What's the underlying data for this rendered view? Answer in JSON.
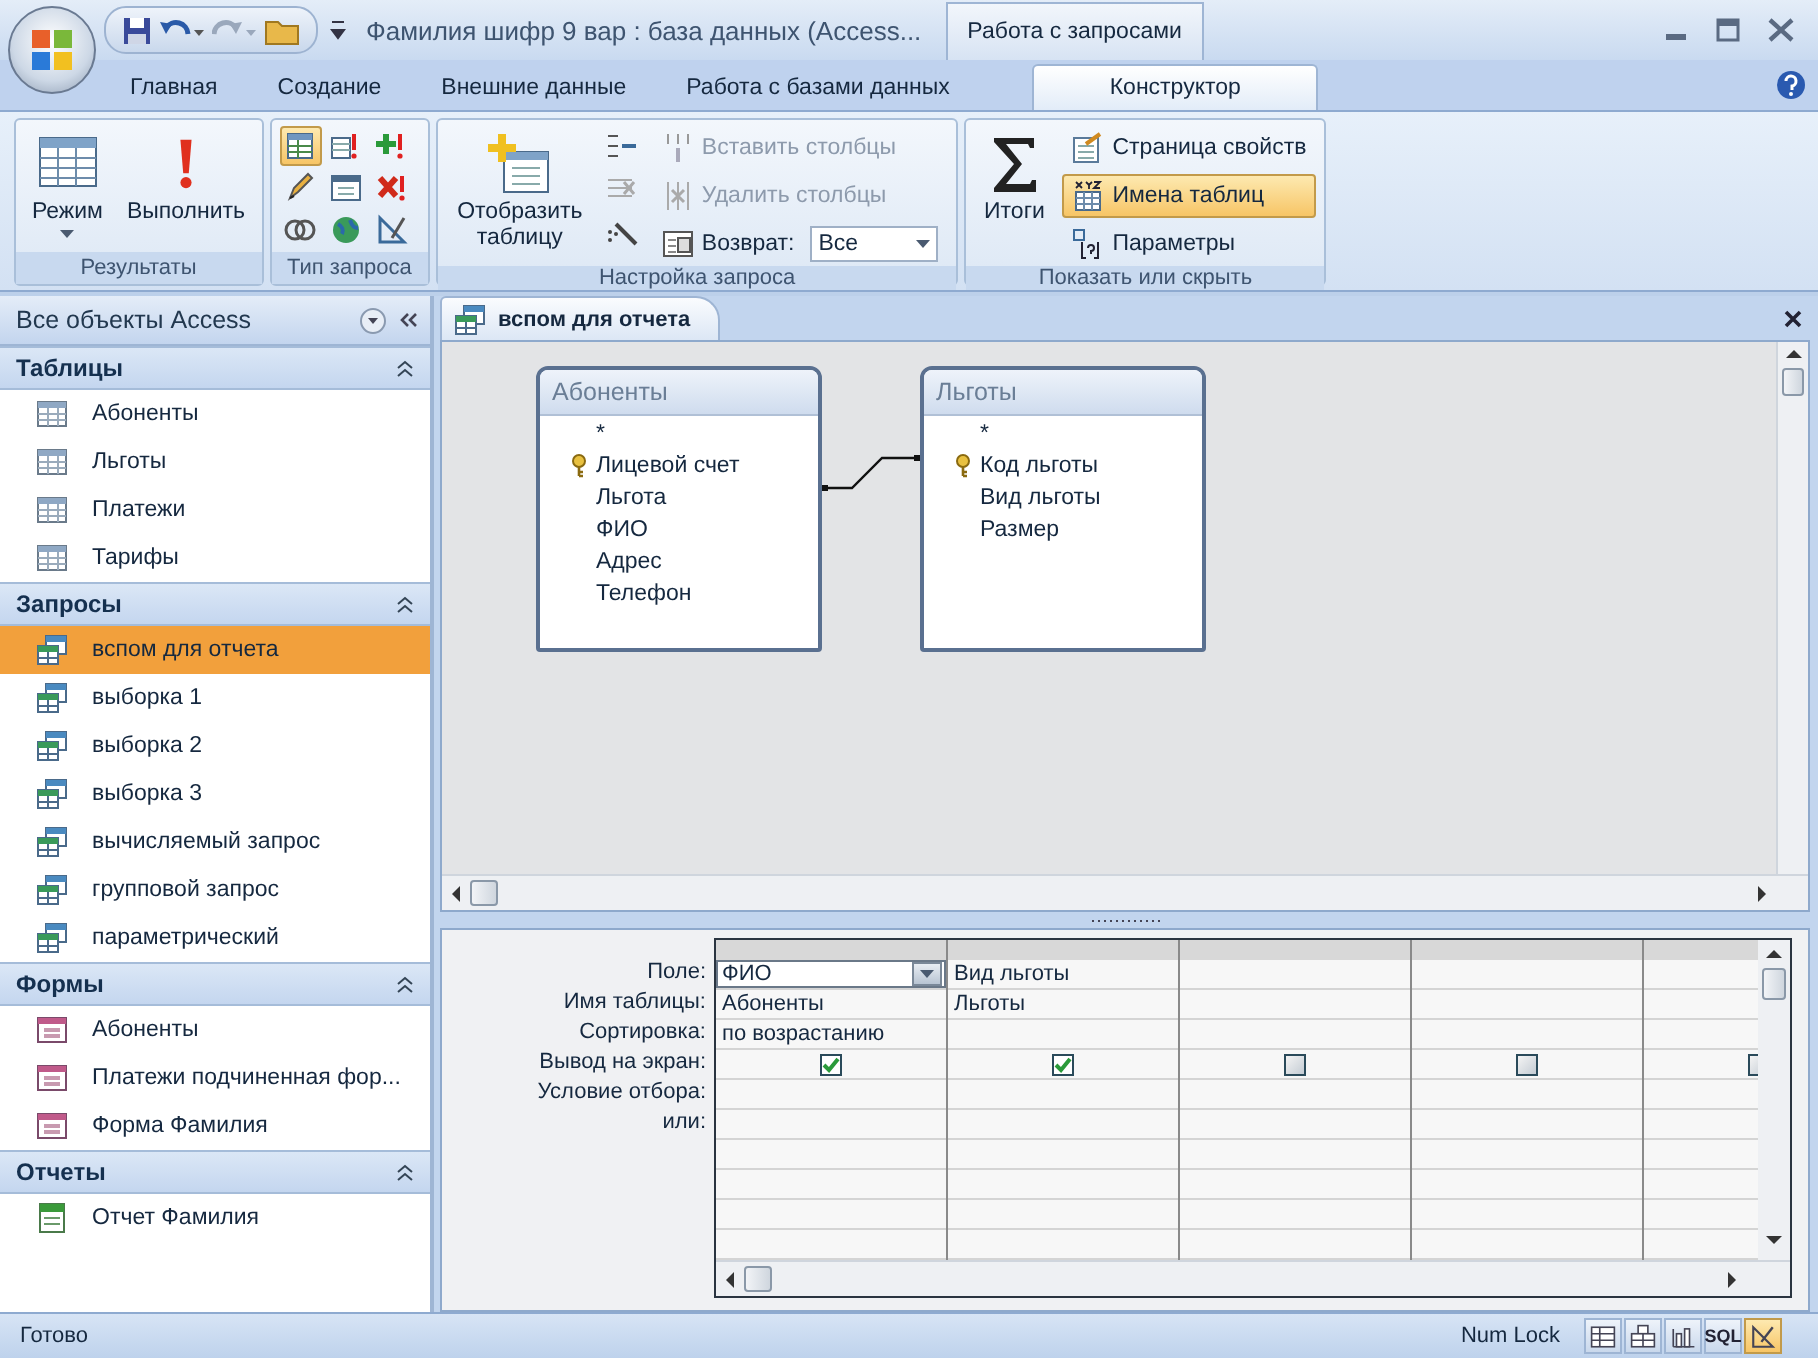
{
  "window": {
    "title": "Фамилия шифр 9 вар : база данных (Access..."
  },
  "context_tab_group": "Работа с запросами",
  "ribbon_tabs": [
    {
      "label": "Главная",
      "selected": false
    },
    {
      "label": "Создание",
      "selected": false
    },
    {
      "label": "Внешние данные",
      "selected": false
    },
    {
      "label": "Работа с базами данных",
      "selected": false
    },
    {
      "label": "Конструктор",
      "selected": true
    }
  ],
  "ribbon_groups": [
    {
      "title": "Результаты",
      "large": [
        {
          "kind": "view",
          "label": "Режим",
          "dropdown": true
        },
        {
          "kind": "run",
          "label": "Выполнить",
          "dropdown": false
        }
      ]
    },
    {
      "title": "Тип запроса",
      "icons": [
        {
          "kind": "select",
          "selected": true
        },
        {
          "kind": "update",
          "selected": false
        },
        {
          "kind": "crosstab",
          "selected": false
        },
        {
          "kind": "make-table",
          "selected": false
        },
        {
          "kind": "union",
          "selected": false
        },
        {
          "kind": "pass-through",
          "selected": false
        },
        {
          "kind": "append",
          "selected": false
        },
        {
          "kind": "delete",
          "selected": false
        },
        {
          "kind": "data-definition",
          "selected": false
        }
      ]
    },
    {
      "title": "Настройка запроса",
      "large": [
        {
          "kind": "show-table",
          "label": "Отобразить таблицу",
          "dropdown": false
        }
      ],
      "icons": [
        {
          "kind": "insert-rows",
          "selected": false
        },
        {
          "kind": "delete-rows",
          "selected": false
        },
        {
          "kind": "builder",
          "selected": false
        }
      ],
      "rows": [
        {
          "kind": "insert-columns",
          "label": "Вставить столбцы",
          "disabled": true,
          "selected": false
        },
        {
          "kind": "delete-columns",
          "label": "Удалить столбцы",
          "disabled": true,
          "selected": false
        },
        {
          "kind": "return",
          "label": "Возврат:",
          "value": "Все",
          "disabled": false,
          "selected": false
        }
      ]
    },
    {
      "title": "Показать или скрыть",
      "large": [
        {
          "kind": "totals",
          "label": "Итоги",
          "dropdown": false
        }
      ],
      "rows": [
        {
          "kind": "property-sheet",
          "label": "Страница свойств",
          "disabled": false,
          "selected": false
        },
        {
          "kind": "table-names",
          "label": "Имена таблиц",
          "disabled": false,
          "selected": true
        },
        {
          "kind": "parameters",
          "label": "Параметры",
          "disabled": false,
          "selected": false
        }
      ]
    }
  ],
  "nav_pane": {
    "title": "Все объекты Access",
    "sections": [
      {
        "title": "Таблицы",
        "expanded": true,
        "items": [
          {
            "kind": "table",
            "label": "Абоненты",
            "selected": false
          },
          {
            "kind": "table",
            "label": "Льготы",
            "selected": false
          },
          {
            "kind": "table",
            "label": "Платежи",
            "selected": false
          },
          {
            "kind": "table",
            "label": "Тарифы",
            "selected": false
          }
        ]
      },
      {
        "title": "Запросы",
        "expanded": true,
        "items": [
          {
            "kind": "query",
            "label": "вспом для отчета",
            "selected": true
          },
          {
            "kind": "query",
            "label": "выборка 1",
            "selected": false
          },
          {
            "kind": "query",
            "label": "выборка 2",
            "selected": false
          },
          {
            "kind": "query",
            "label": "выборка 3",
            "selected": false
          },
          {
            "kind": "query",
            "label": "вычисляемый запрос",
            "selected": false
          },
          {
            "kind": "query",
            "label": "групповой запрос",
            "selected": false
          },
          {
            "kind": "query",
            "label": "параметрический",
            "selected": false
          }
        ]
      },
      {
        "title": "Формы",
        "expanded": true,
        "items": [
          {
            "kind": "form",
            "label": "Абоненты",
            "selected": false
          },
          {
            "kind": "form",
            "label": "Платежи подчиненная фор...",
            "selected": false
          },
          {
            "kind": "form",
            "label": "Форма Фамилия",
            "selected": false
          }
        ]
      },
      {
        "title": "Отчеты",
        "expanded": true,
        "items": [
          {
            "kind": "report",
            "label": "Отчет Фамилия",
            "selected": false
          }
        ]
      }
    ]
  },
  "document_tab": {
    "label": "вспом для отчета"
  },
  "query_tables": [
    {
      "title": "Абоненты",
      "fields": [
        {
          "name": "*",
          "key": false
        },
        {
          "name": "Лицевой счет",
          "key": true
        },
        {
          "name": "Льгота",
          "key": false
        },
        {
          "name": "ФИО",
          "key": false
        },
        {
          "name": "Адрес",
          "key": false
        },
        {
          "name": "Телефон",
          "key": false
        }
      ]
    },
    {
      "title": "Льготы",
      "fields": [
        {
          "name": "*",
          "key": false
        },
        {
          "name": "Код льготы",
          "key": true
        },
        {
          "name": "Вид льготы",
          "key": false
        },
        {
          "name": "Размер",
          "key": false
        }
      ]
    }
  ],
  "design_grid": {
    "row_labels": [
      "Поле:",
      "Имя таблицы:",
      "Сортировка:",
      "Вывод на экран:",
      "Условие отбора:",
      "или:"
    ],
    "columns": [
      {
        "field": "ФИО",
        "table": "Абоненты",
        "sort": "по возрастанию",
        "show": true,
        "active": true
      },
      {
        "field": "Вид льготы",
        "table": "Льготы",
        "show": true,
        "active": false
      },
      {
        "show": false,
        "active": false
      },
      {
        "show": false,
        "active": false
      },
      {
        "show": false,
        "active": false
      }
    ]
  },
  "status_bar": {
    "text": "Готово",
    "num_lock": "Num Lock",
    "view_buttons": [
      {
        "kind": "datasheet",
        "selected": false
      },
      {
        "kind": "pivot-table",
        "selected": false
      },
      {
        "kind": "pivot-chart",
        "selected": false
      },
      {
        "kind": "sql",
        "label": "SQL",
        "selected": false
      },
      {
        "kind": "design",
        "selected": true
      }
    ]
  }
}
